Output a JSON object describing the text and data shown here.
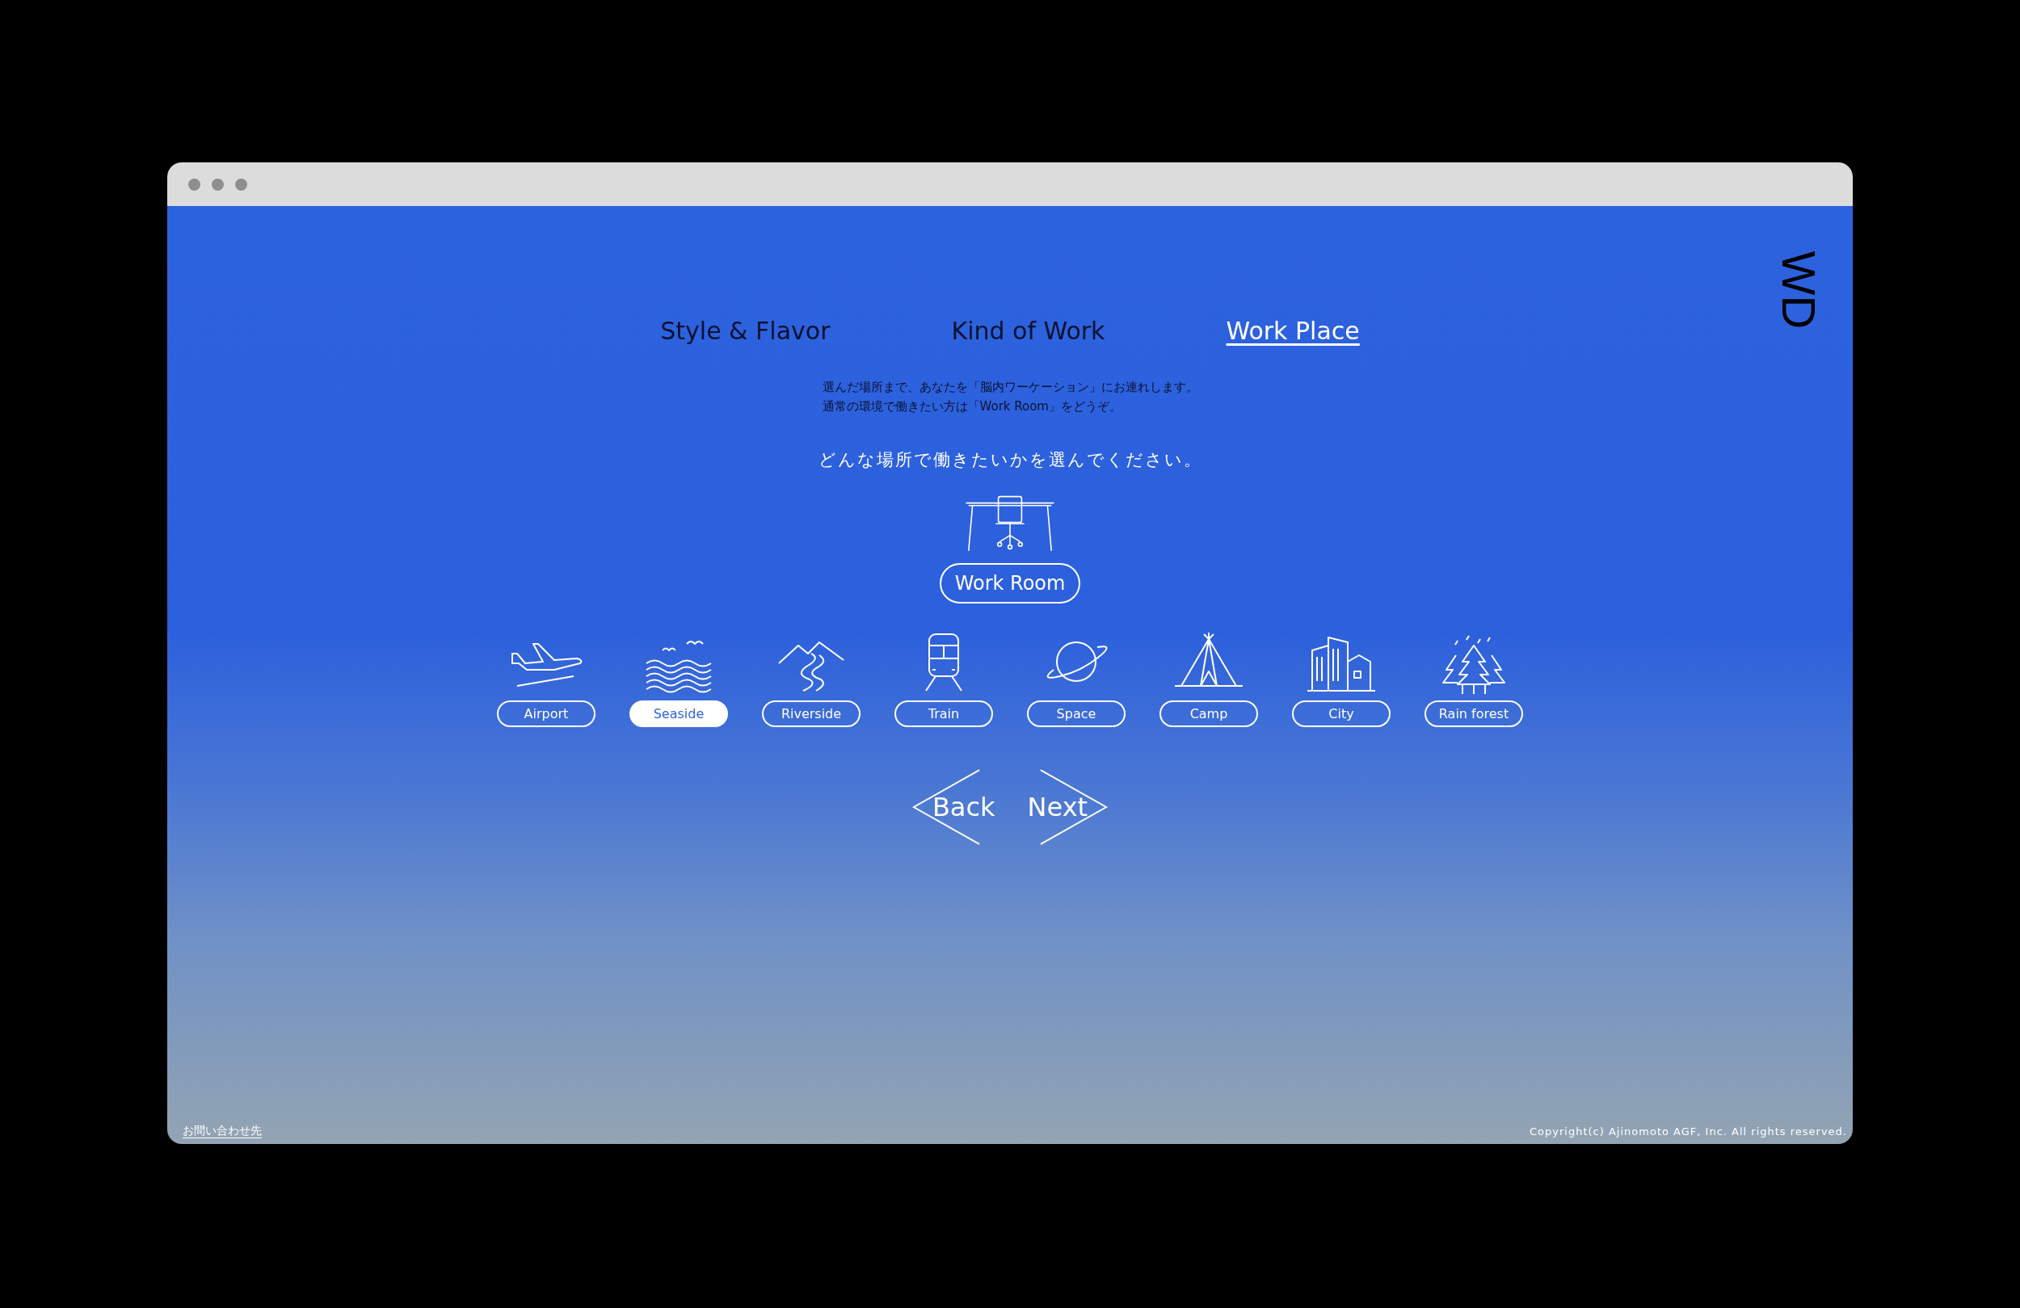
{
  "logo": "WD",
  "tabs": [
    {
      "label": "Style & Flavor",
      "selected": false
    },
    {
      "label": "Kind of Work",
      "selected": false
    },
    {
      "label": "Work Place",
      "selected": true
    }
  ],
  "description": [
    "選んだ場所まで、あなたを「脳内ワーケーション」にお連れします。",
    "通常の環境で働きたい方は「Work Room」をどうぞ。"
  ],
  "prompt": "どんな場所で働きたいかを選んでください。",
  "work_room": {
    "label": "Work Room",
    "selected": false
  },
  "places": [
    {
      "label": "Airport",
      "selected": false
    },
    {
      "label": "Seaside",
      "selected": true
    },
    {
      "label": "Riverside",
      "selected": false
    },
    {
      "label": "Train",
      "selected": false
    },
    {
      "label": "Space",
      "selected": false
    },
    {
      "label": "Camp",
      "selected": false
    },
    {
      "label": "City",
      "selected": false
    },
    {
      "label": "Rain forest",
      "selected": false
    }
  ],
  "nav": {
    "back": "Back",
    "next": "Next"
  },
  "footer": {
    "contact": "お問い合わせ先",
    "copyright": "Copyright(c) Ajinomoto AGF, Inc. All rights reserved."
  }
}
